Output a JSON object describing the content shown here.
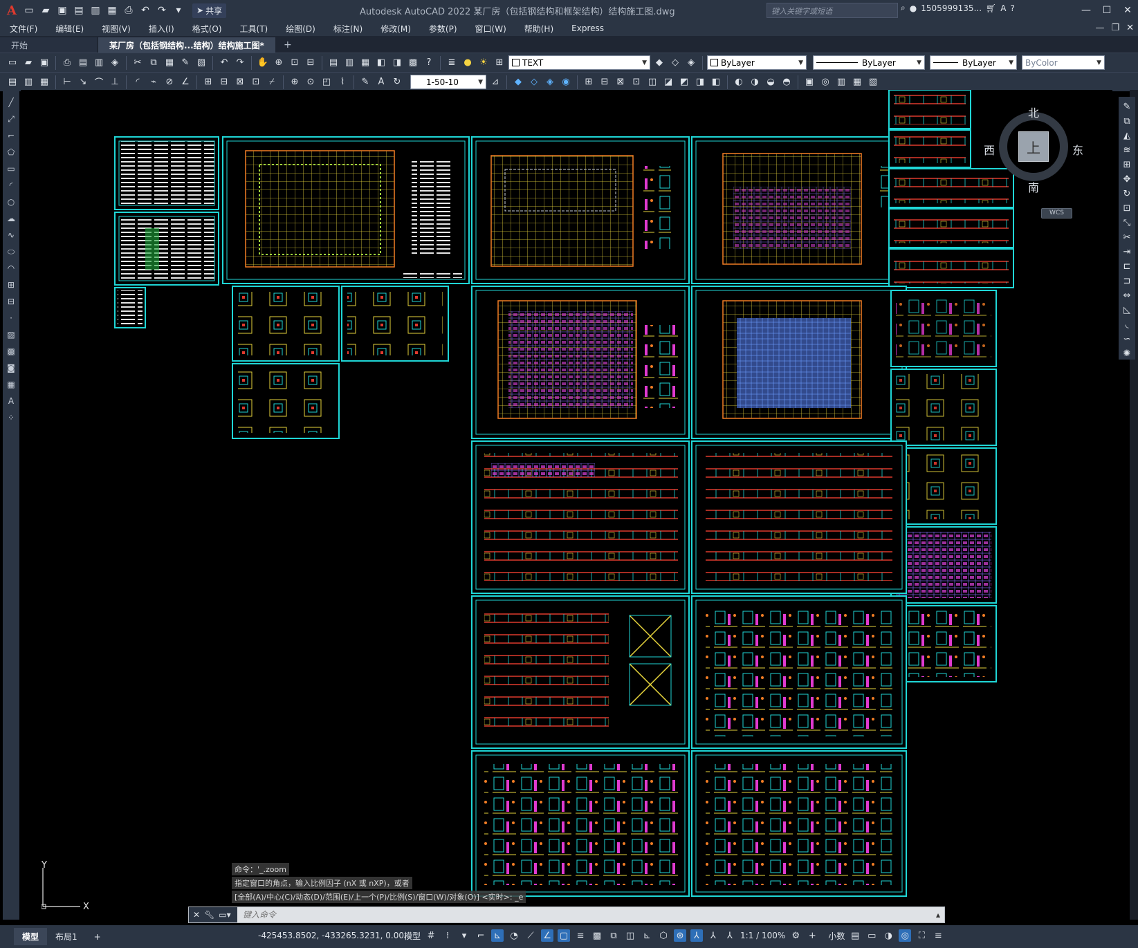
{
  "titlebar": {
    "logo": "A",
    "share": "共享",
    "title": "Autodesk AutoCAD 2022    某厂房（包括钢结构和框架结构）结构施工图.dwg",
    "search_placeholder": "键入关键字或短语",
    "user": "1505999135...",
    "help": "?"
  },
  "menu": [
    "文件(F)",
    "编辑(E)",
    "视图(V)",
    "插入(I)",
    "格式(O)",
    "工具(T)",
    "绘图(D)",
    "标注(N)",
    "修改(M)",
    "参数(P)",
    "窗口(W)",
    "帮助(H)",
    "Express"
  ],
  "tabs": [
    {
      "label": "开始"
    },
    {
      "label": "某厂房（包括钢结构...结构）结构施工图*"
    }
  ],
  "toolbar1": {
    "text_style": "TEXT",
    "layer": "ByLayer",
    "linetype": "ByLayer",
    "lineweight": "ByLayer",
    "plotstyle": "ByColor"
  },
  "toolbar2": {
    "dim_style": "1-50-10"
  },
  "viewcube": {
    "north": "北",
    "south": "南",
    "east": "东",
    "west": "西",
    "face": "上",
    "wcs": "WCS"
  },
  "ucs": {
    "x": "X",
    "y": "Y"
  },
  "command": {
    "history": [
      "命令：'_.zoom",
      "指定窗口的角点，输入比例因子 (nX 或 nXP)，或者",
      "[全部(A)/中心(C)/动态(D)/范围(E)/上一个(P)/比例(S)/窗口(W)/对象(O)] <实时>: _e"
    ],
    "placeholder": "键入命令"
  },
  "status": {
    "layouts": [
      "模型",
      "布局1"
    ],
    "coords": "-425453.8502, -433265.3231, 0.00...",
    "model": "模型",
    "scale": "1:1 / 100%",
    "units": "小数"
  },
  "colors": {
    "sheet_border": "#1fd6d6",
    "titlebar": "#2b3544",
    "canvas": "#000000"
  }
}
